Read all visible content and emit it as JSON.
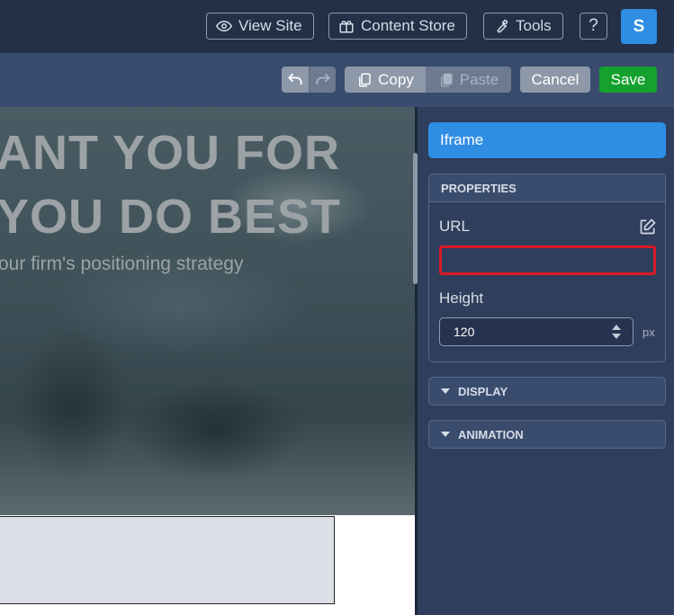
{
  "topbar": {
    "view_site": "View Site",
    "content_store": "Content Store",
    "tools": "Tools",
    "help": "?",
    "avatar_initial": "S"
  },
  "toolbar": {
    "copy": "Copy",
    "paste": "Paste",
    "cancel": "Cancel",
    "save": "Save"
  },
  "canvas": {
    "hero_line1": "ANT YOU FOR",
    "hero_line2": "YOU DO BEST",
    "hero_subtitle": "our firm's positioning strategy"
  },
  "panel": {
    "title": "Iframe",
    "properties_header": "PROPERTIES",
    "url_label": "URL",
    "url_value": "",
    "height_label": "Height",
    "height_value": "120",
    "height_unit": "px",
    "sections": [
      "DISPLAY",
      "ANIMATION"
    ]
  },
  "colors": {
    "accent": "#2f8de4",
    "save": "#14a12e",
    "error_border": "#d81b27",
    "panel_bg": "#2f3e5c",
    "topbar_bg": "#233047"
  },
  "icons": [
    "eye-icon",
    "gift-icon",
    "wrench-icon",
    "undo-icon",
    "redo-icon",
    "copy-icon",
    "paste-icon",
    "edit-icon",
    "spinner-icon",
    "caret-down-icon"
  ]
}
